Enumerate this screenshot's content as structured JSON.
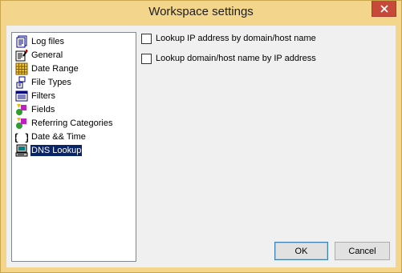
{
  "window": {
    "title": "Workspace settings"
  },
  "tree": {
    "items": [
      {
        "label": "Log files",
        "icon": "log-files-icon"
      },
      {
        "label": "General",
        "icon": "general-icon"
      },
      {
        "label": "Date Range",
        "icon": "calendar-icon"
      },
      {
        "label": "File Types",
        "icon": "file-types-icon"
      },
      {
        "label": "Filters",
        "icon": "filters-icon"
      },
      {
        "label": "Fields",
        "icon": "fields-icon"
      },
      {
        "label": "Referring Categories",
        "icon": "referring-categories-icon"
      },
      {
        "label": "Date && Time",
        "icon": "braces-icon"
      },
      {
        "label": "DNS Lookup",
        "icon": "computer-icon"
      }
    ],
    "selected": "DNS Lookup"
  },
  "options": {
    "lookup_ip": {
      "label": "Lookup IP address by domain/host name",
      "checked": false
    },
    "lookup_domain": {
      "label": "Lookup domain/host name by IP address",
      "checked": false
    }
  },
  "buttons": {
    "ok": "OK",
    "cancel": "Cancel"
  },
  "colors": {
    "title_bar": "#f3d58c",
    "close_button": "#c7493a",
    "selection": "#0a246a",
    "dialog_bg": "#f0f0f0"
  }
}
